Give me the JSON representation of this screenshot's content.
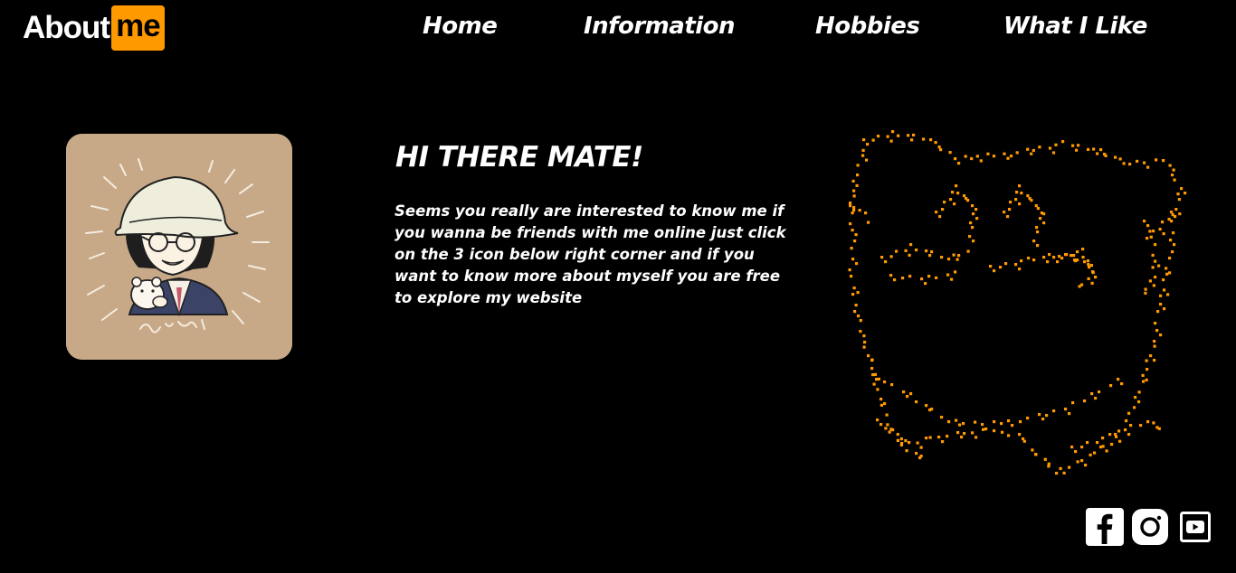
{
  "logo": {
    "part1": "About",
    "part2": "me",
    "accent_color": "#ff9900"
  },
  "nav": {
    "items": [
      {
        "label": "Home"
      },
      {
        "label": "Information"
      },
      {
        "label": "Hobbies"
      },
      {
        "label": "What I Like"
      }
    ]
  },
  "avatar": {
    "icon": "cartoon-avatar-illustration",
    "background_color": "#c7a988"
  },
  "intro": {
    "title": "HI THERE MATE!",
    "body": "Seems you really are interested to know me if you wanna be friends with me online just click on the 3 icon below right corner and if you want to know more about myself you are free to explore my website"
  },
  "decoration": {
    "icon": "dot-art-bear-face",
    "color": "#ff9900"
  },
  "social": {
    "icons": [
      "facebook-icon",
      "instagram-icon",
      "youtube-icon"
    ]
  }
}
